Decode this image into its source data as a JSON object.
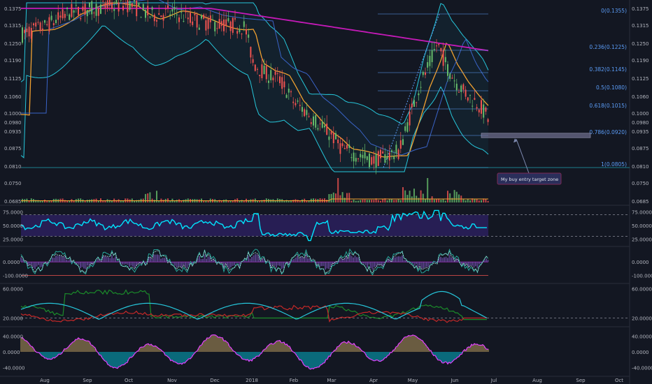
{
  "colors": {
    "background": "#131722",
    "divider": "#2a2e39",
    "fib": "#5b9cf6",
    "bb": "#26c6da",
    "ema": "#f0a030",
    "ma200": "#c51ab8",
    "ma_blue": "#3a64c8",
    "bull": "#66bb6a",
    "bear": "#ef5350",
    "rsi": "#00e5ff",
    "rsi_band": "#2a1f5a",
    "cci": "#26a69a",
    "dmi_plus": "#1b8a2a",
    "dmi_minus": "#c62828",
    "adx": "#26c6da",
    "zone": "#6b6b8a",
    "hist_up": "#c0a060",
    "hist_down": "#00bcd4",
    "osc_line": "#e040fb"
  },
  "chart_data": [
    {
      "type": "candlestick",
      "name": "price",
      "x_labels": [
        "Aug",
        "Sep",
        "Oct",
        "Nov",
        "Dec",
        "2018",
        "Feb",
        "Mar",
        "Apr",
        "May",
        "Jun",
        "Jul",
        "Aug",
        "Sep",
        "Oct"
      ],
      "y_ticks": [
        "0.1375",
        "0.1315",
        "0.1250",
        "0.1190",
        "0.1125",
        "0.1060",
        "0.1000",
        "0.0935",
        "0.0875",
        "0.0810",
        "0.0750",
        "0.0685"
      ],
      "y_left_ticks": [
        "0.1375",
        "0.1315",
        "0.1250",
        "0.1190",
        "0.1125",
        "0.1060",
        "0.1000",
        "0.0935",
        "0.0875",
        "0.0810",
        "0.0750",
        "0.0685"
      ],
      "current_price": "0.0980",
      "ylim": [
        0.0685,
        0.1375
      ],
      "fib_levels": [
        {
          "ratio": "0",
          "price": 0.1355,
          "label": "0(0.1355)"
        },
        {
          "ratio": "0.236",
          "price": 0.1225,
          "label": "0.236(0.1225)"
        },
        {
          "ratio": "0.382",
          "price": 0.1145,
          "label": "0.382(0.1145)"
        },
        {
          "ratio": "0.5",
          "price": 0.108,
          "label": "0.5(0.1080)"
        },
        {
          "ratio": "0.618",
          "price": 0.1015,
          "label": "0.618(0.1015)"
        },
        {
          "ratio": "0.786",
          "price": 0.092,
          "label": "0.786(0.0920)"
        },
        {
          "ratio": "1",
          "price": 0.0805,
          "label": "1(0.0805)"
        }
      ],
      "annotation": "My buy entry target zone",
      "target_zone": [
        0.0912,
        0.0928
      ]
    },
    {
      "type": "line",
      "name": "RSI",
      "y_ticks": [
        "75.0000",
        "50.0000",
        "25.0000"
      ],
      "ylim": [
        15,
        85
      ],
      "bands": [
        70,
        30
      ]
    },
    {
      "type": "line",
      "name": "CCI",
      "y_ticks": [
        "0.0000",
        "-100.0000"
      ],
      "left_ticks": [
        "0.0000",
        "-100.0000"
      ],
      "ylim": [
        -150,
        100
      ]
    },
    {
      "type": "line",
      "name": "DMI/ADX",
      "y_ticks": [
        "60.0000",
        "20.0000"
      ],
      "ylim": [
        10,
        65
      ]
    },
    {
      "type": "histogram",
      "name": "Momentum",
      "y_ticks": [
        "40.0000",
        "0.0000",
        "-40.0000"
      ],
      "ylim": [
        -60,
        60
      ]
    }
  ]
}
